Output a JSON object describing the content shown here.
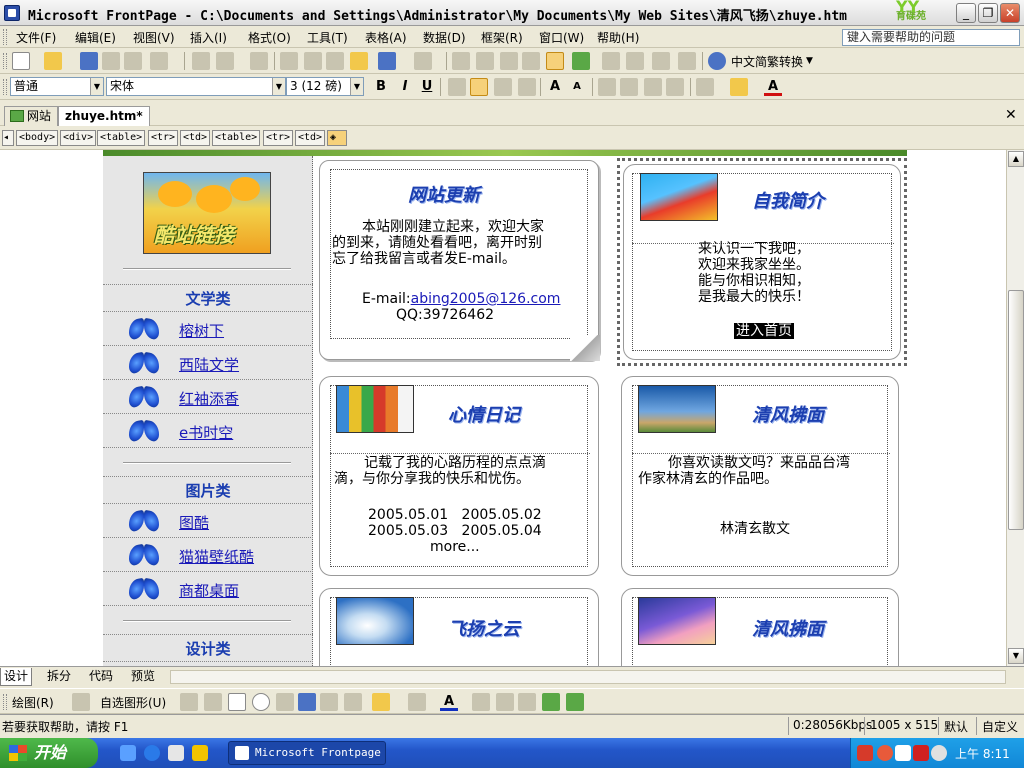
{
  "window": {
    "title": "Microsoft FrontPage - C:\\Documents and Settings\\Administrator\\My Documents\\My Web Sites\\清风飞扬\\zhuye.htm",
    "brand": "育碟苑"
  },
  "menu": {
    "items": [
      "文件(F)",
      "编辑(E)",
      "视图(V)",
      "插入(I)",
      "格式(O)",
      "工具(T)",
      "表格(A)",
      "数据(D)",
      "框架(R)",
      "窗口(W)",
      "帮助(H)"
    ],
    "help_placeholder": "键入需要帮助的问题"
  },
  "toolbar": {
    "chinese_convert": "中文简繁转换",
    "style": "普通",
    "font": "宋体",
    "size": "3 (12 磅)"
  },
  "tabs": {
    "site": "网站",
    "doc": "zhuye.htm*"
  },
  "tag_path": [
    "<body>",
    "<div>",
    "<table>",
    "<tr>",
    "<td>",
    "<table>",
    "<tr>",
    "<td>"
  ],
  "left": {
    "banner_text": "酷站链接",
    "categories": [
      {
        "title": "文学类",
        "links": [
          "榕树下",
          "西陆文学",
          "红袖添香",
          "e书时空"
        ]
      },
      {
        "title": "图片类",
        "links": [
          "图酷",
          "猫猫壁纸酷",
          "商都桌面"
        ]
      },
      {
        "title": "设计类",
        "links": []
      }
    ]
  },
  "cards": {
    "news": {
      "title": "网站更新",
      "lines": [
        "本站刚刚建立起来，欢迎大家",
        "的到来，请随处看看吧，离开时别",
        "忘了给我留言或者发E-mail。"
      ],
      "email_label": "E-mail:",
      "email": "abing2005@126.com",
      "qq": "QQ:39726462"
    },
    "intro": {
      "title": "自我简介",
      "lines": [
        "来认识一下我吧，",
        "欢迎来我家坐坐。",
        "能与你相识相知，",
        "是我最大的快乐！"
      ],
      "enter": "进入首页"
    },
    "diary": {
      "title": "心情日记",
      "lines": [
        "记载了我的心路历程的点点滴",
        "滴，与你分享我的快乐和忧伤。"
      ],
      "dates": [
        "2005.05.01",
        "2005.05.02",
        "2005.05.03",
        "2005.05.04"
      ],
      "more": "more..."
    },
    "prose": {
      "title": "清风拂面",
      "lines": [
        "你喜欢读散文吗？来品品台湾",
        "作家林清玄的作品吧。"
      ],
      "author": "林清玄散文"
    },
    "cloud": {
      "title": "飞扬之云"
    },
    "breeze": {
      "title": "清风拂面"
    }
  },
  "views": [
    "设计",
    "拆分",
    "代码",
    "预览"
  ],
  "drawbar": {
    "draw": "绘图(R)",
    "autoshape": "自选图形(U)"
  },
  "status": {
    "help": "若要获取帮助，请按 F1",
    "speed": "0:28056Kbps",
    "dims": "1005 x 515",
    "default": "默认",
    "custom": "自定义"
  },
  "taskbar": {
    "start": "开始",
    "item": "Microsoft Frontpage",
    "clock": "上午 8:11"
  }
}
